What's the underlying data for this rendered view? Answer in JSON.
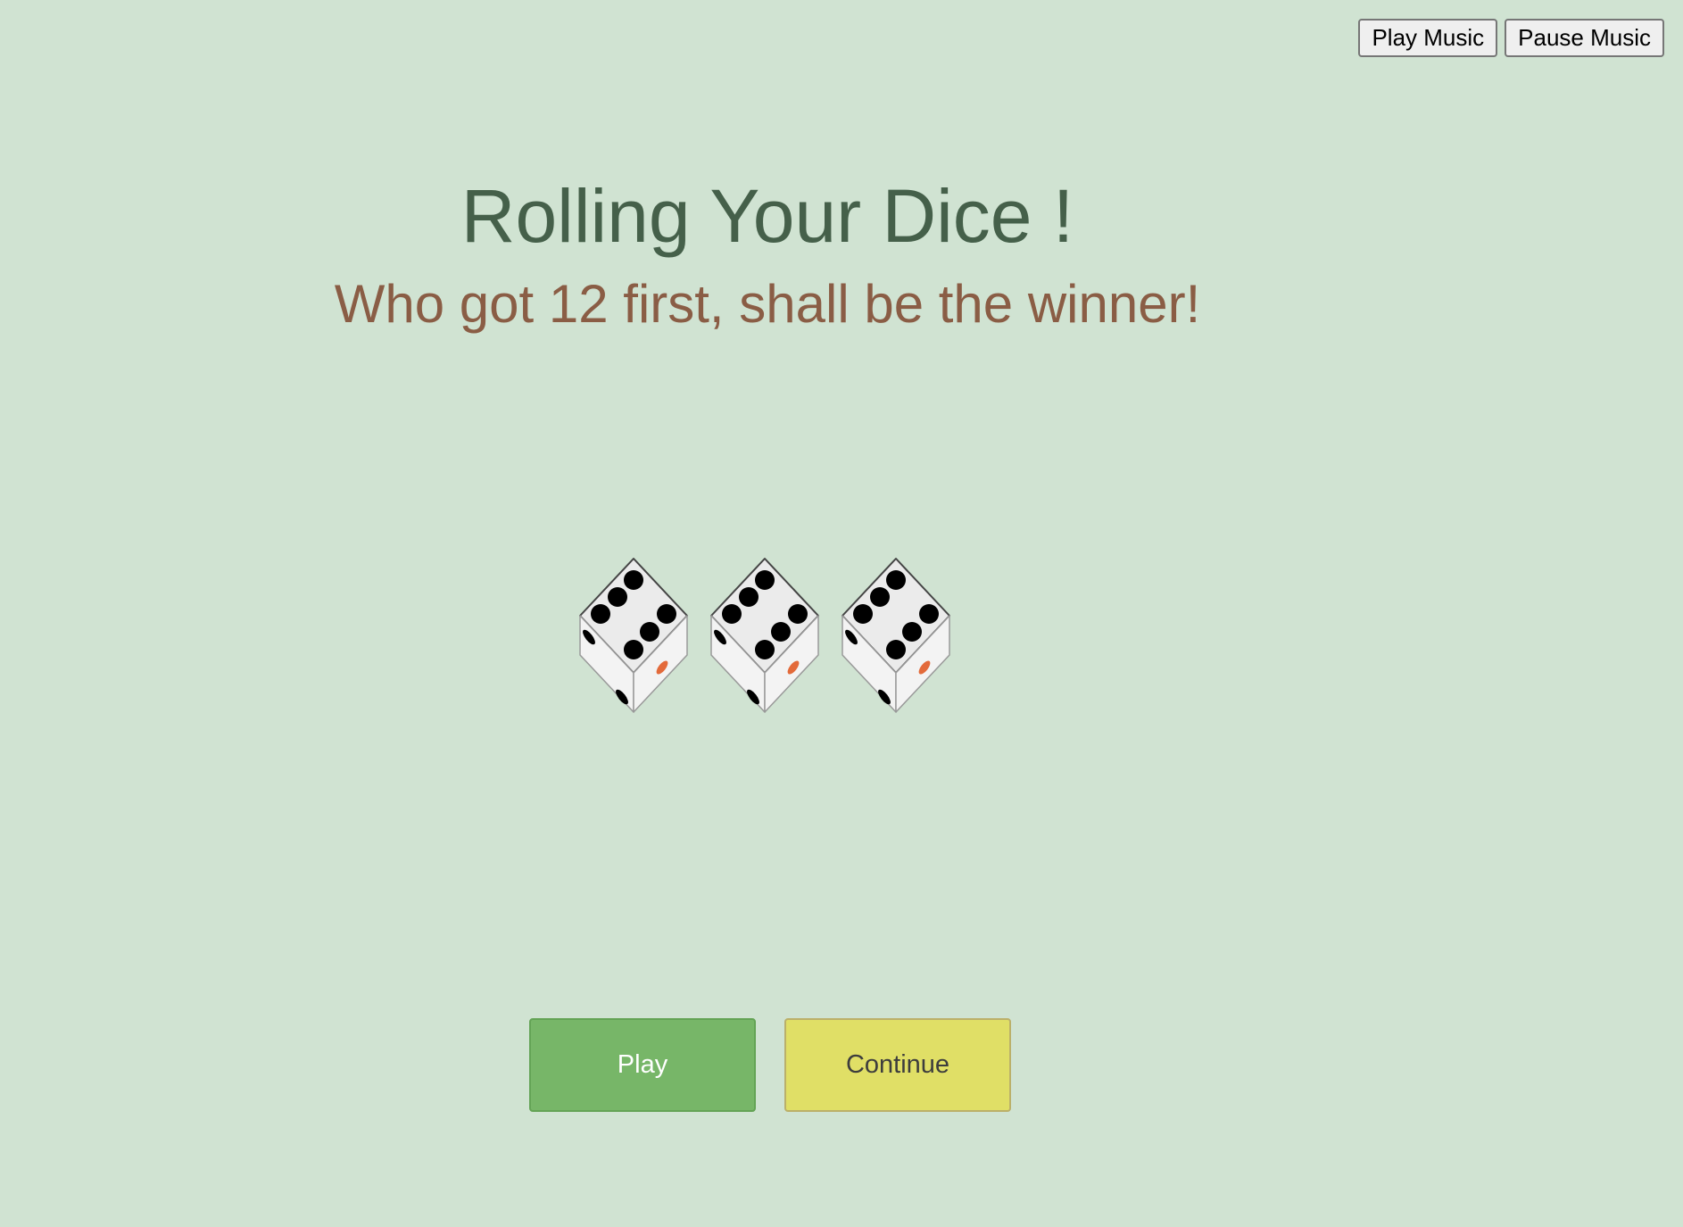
{
  "music": {
    "play_label": "Play Music",
    "pause_label": "Pause Music"
  },
  "header": {
    "title": "Rolling Your Dice !",
    "subtitle": "Who got 12 first, shall be the winner!"
  },
  "dice": [
    {
      "top_face": 6
    },
    {
      "top_face": 6
    },
    {
      "top_face": 6
    }
  ],
  "actions": {
    "play_label": "Play",
    "continue_label": "Continue"
  },
  "colors": {
    "background": "#d0e3d2",
    "title": "#45604a",
    "subtitle": "#8a5d45",
    "play_button": "#77b668",
    "continue_button": "#e0df66"
  }
}
